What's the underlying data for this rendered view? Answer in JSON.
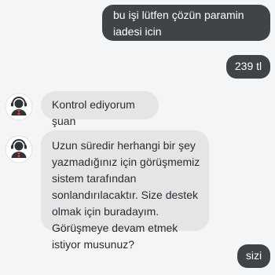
{
  "conversation": {
    "messages": [
      {
        "sender": "user",
        "text": "bu işi lütfen çözün paramin iadesi icin"
      },
      {
        "sender": "user",
        "text": "239 tl"
      },
      {
        "sender": "agent",
        "text": "Kontrol ediyorum şuan"
      },
      {
        "sender": "agent",
        "text": "Uzun süredir herhangi bir şey yazmadığınız için görüşmemiz sistem tarafından sonlandırılacaktır. Size destek olmak için buradayım. Görüşmeye devam etmek istiyor musunuz?"
      },
      {
        "sender": "user",
        "text": "sizi"
      }
    ]
  },
  "colors": {
    "background": "#f4f5f6",
    "user_bubble": "#3e4448",
    "agent_bubble": "#e4e5e7",
    "agent_avatar_background": "#ffffff",
    "agent_avatar_figure": "#2f3437",
    "agent_avatar_accent": "#d9433a"
  },
  "icons": {
    "agent_avatar": "support-agent-icon"
  }
}
